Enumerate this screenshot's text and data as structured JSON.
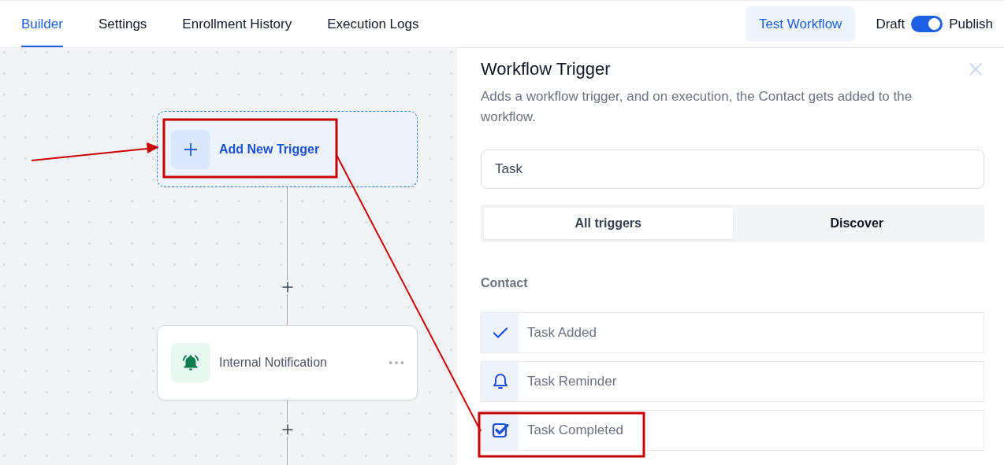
{
  "tabs": [
    {
      "label": "Builder",
      "selected": true
    },
    {
      "label": "Settings",
      "selected": false
    },
    {
      "label": "Enrollment History",
      "selected": false
    },
    {
      "label": "Execution Logs",
      "selected": false
    }
  ],
  "test_button": "Test Workflow",
  "publish_toggle": {
    "off_label": "Draft",
    "on_label": "Publish",
    "on": true
  },
  "canvas": {
    "nodes": [
      {
        "kind": "trigger",
        "label": "Add New Trigger"
      },
      {
        "kind": "add"
      },
      {
        "kind": "action",
        "label": "Internal Notification"
      },
      {
        "kind": "add"
      }
    ]
  },
  "panel": {
    "title": "Workflow Trigger",
    "description": "Adds a workflow trigger, and on execution, the Contact gets added to the workflow.",
    "search": {
      "value": "Task"
    },
    "segments": [
      {
        "label": "All triggers",
        "selected": true
      },
      {
        "label": "Discover",
        "selected": false
      }
    ],
    "section": "Contact",
    "items": [
      {
        "kind": "check",
        "label": "Task Added"
      },
      {
        "kind": "bell",
        "label": "Task Reminder"
      },
      {
        "kind": "checkbox",
        "label": "Task Completed"
      }
    ]
  }
}
